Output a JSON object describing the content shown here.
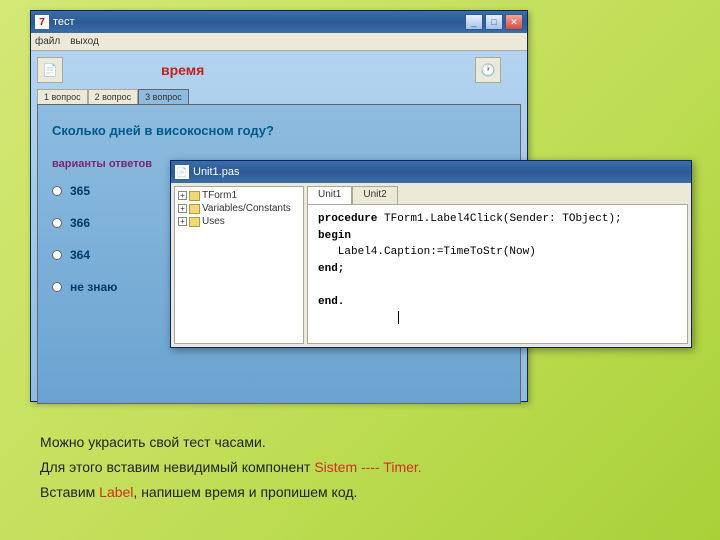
{
  "app": {
    "icon": "7",
    "title": "тест",
    "menu": {
      "file": "файл",
      "exit": "выход"
    },
    "timeLabel": "время",
    "tabs": {
      "t1": "1 вопрос",
      "t2": "2 вопрос",
      "t3": "3 вопрос"
    },
    "question": "Сколько дней в високосном году?",
    "optionsLabel": "варианты ответов",
    "options": {
      "a": "365",
      "b": "366",
      "c": "364",
      "d": "не знаю"
    }
  },
  "editor": {
    "title": "Unit1.pas",
    "tree": {
      "n1": "TForm1",
      "n2": "Variables/Constants",
      "n3": "Uses"
    },
    "tabs": {
      "t1": "Unit1",
      "t2": "Unit2"
    },
    "code": {
      "l1a": "procedure",
      "l1b": " TForm1.Label4Click(Sender: TObject);",
      "l2": "begin",
      "l3": "   Label4.Caption:=TimeToStr(Now)",
      "l4": "end;",
      "l5": "end."
    }
  },
  "caption": {
    "p1": "Можно украсить свой тест часами.",
    "p2a": "Для этого вставим невидимый компонент  ",
    "p2b": "Sistem ---- Timer.",
    "p3a": "Вставим  ",
    "p3b": "Label",
    "p3c": ", напишем время и пропишем код."
  }
}
